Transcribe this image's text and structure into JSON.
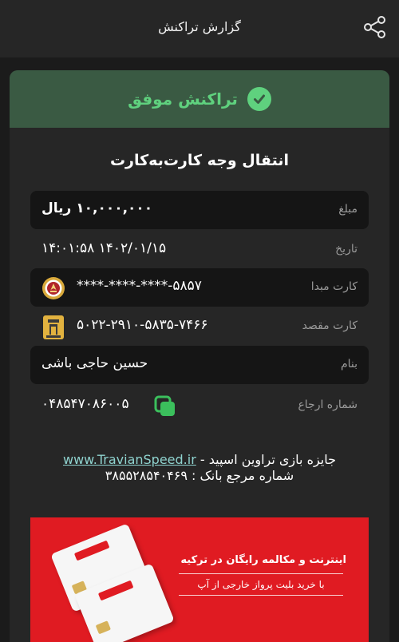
{
  "app_bar": {
    "title": "گزارش تراکنش",
    "share_icon": "share-icon"
  },
  "status": {
    "text": "تراکنش موفق",
    "icon": "check-circle-icon",
    "color": "#5fd17e"
  },
  "transaction": {
    "type": "انتقال وجه کارت‌به‌کارت",
    "rows": [
      {
        "label": "مبلغ",
        "value": "۱۰,۰۰۰,۰۰۰ ریال"
      },
      {
        "label": "تاریخ",
        "value": "۱۴:۰۱:۵۸ ۱۴۰۲/۰۱/۱۵"
      },
      {
        "label": "کارت مبدا",
        "value": "****-****-****-۵۸۵۷",
        "icon": "bank-melli-logo"
      },
      {
        "label": "کارت مقصد",
        "value": "۵۰۲۲-۲۹۱۰-۵۸۳۵-۷۴۶۶",
        "icon": "bank-pasargad-logo"
      },
      {
        "label": "بنام",
        "value": "حسین حاجی باشی"
      },
      {
        "label": "شماره ارجاع",
        "value": "۰۴۸۵۴۷۰۸۶۰۰۵",
        "icon": "copy-icon"
      }
    ]
  },
  "info": {
    "line1_prefix": "جایزه بازی تراوین اسپید - ",
    "line1_link": "www.TravianSpeed.ir",
    "line2": "شماره مرجع بانک : ۳۸۵۵۲۸۵۴۰۴۶۹"
  },
  "banner": {
    "title": "اینترنت و مکالمه رایگان در ترکیه",
    "subtitle": "با خرید بلیت پرواز خارجی از آپ",
    "background": "#e01b22"
  }
}
